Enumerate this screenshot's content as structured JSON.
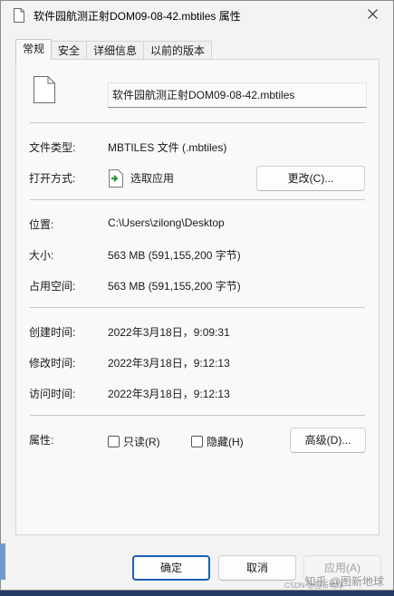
{
  "window": {
    "title": "软件园航测正射DOM09-08-42.mbtiles 属性",
    "close_icon": "close-icon"
  },
  "tabs": [
    {
      "label": "常规",
      "active": true
    },
    {
      "label": "安全",
      "active": false
    },
    {
      "label": "详细信息",
      "active": false
    },
    {
      "label": "以前的版本",
      "active": false
    }
  ],
  "general": {
    "file_name": "软件园航测正射DOM09-08-42.mbtiles",
    "file_type_label": "文件类型:",
    "file_type_value": "MBTILES 文件 (.mbtiles)",
    "open_with_label": "打开方式:",
    "open_with_value": "选取应用",
    "change_button": "更改(C)...",
    "location_label": "位置:",
    "location_value": "C:\\Users\\zilong\\Desktop",
    "size_label": "大小:",
    "size_value": "563 MB (591,155,200 字节)",
    "size_on_disk_label": "占用空间:",
    "size_on_disk_value": "563 MB (591,155,200 字节)",
    "created_label": "创建时间:",
    "created_value": "2022年3月18日，9:09:31",
    "modified_label": "修改时间:",
    "modified_value": "2022年3月18日，9:12:13",
    "accessed_label": "访问时间:",
    "accessed_value": "2022年3月18日，9:12:13",
    "attributes_label": "属性:",
    "readonly_label": "只读(R)",
    "hidden_label": "隐藏(H)",
    "advanced_button": "高级(D)..."
  },
  "footer": {
    "ok": "确定",
    "cancel": "取消",
    "apply": "应用(A)"
  },
  "watermark": {
    "main": "知乎 @图新地球",
    "small": "CSDN @图新地球"
  }
}
